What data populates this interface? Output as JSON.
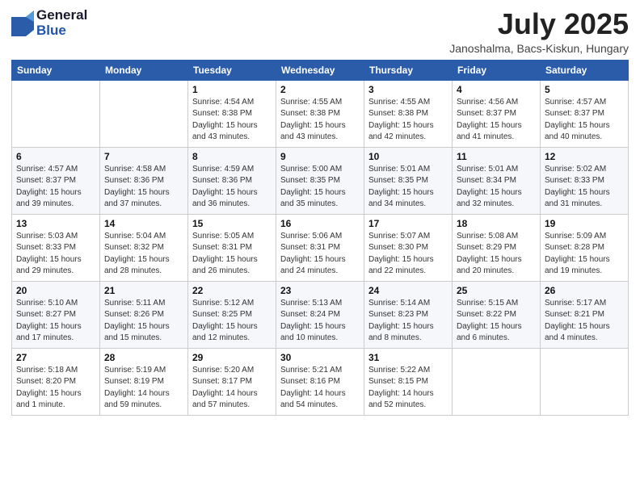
{
  "header": {
    "logo_general": "General",
    "logo_blue": "Blue",
    "title": "July 2025",
    "location": "Janoshalma, Bacs-Kiskun, Hungary"
  },
  "days_of_week": [
    "Sunday",
    "Monday",
    "Tuesday",
    "Wednesday",
    "Thursday",
    "Friday",
    "Saturday"
  ],
  "weeks": [
    [
      {
        "day": "",
        "detail": ""
      },
      {
        "day": "",
        "detail": ""
      },
      {
        "day": "1",
        "detail": "Sunrise: 4:54 AM\nSunset: 8:38 PM\nDaylight: 15 hours\nand 43 minutes."
      },
      {
        "day": "2",
        "detail": "Sunrise: 4:55 AM\nSunset: 8:38 PM\nDaylight: 15 hours\nand 43 minutes."
      },
      {
        "day": "3",
        "detail": "Sunrise: 4:55 AM\nSunset: 8:38 PM\nDaylight: 15 hours\nand 42 minutes."
      },
      {
        "day": "4",
        "detail": "Sunrise: 4:56 AM\nSunset: 8:37 PM\nDaylight: 15 hours\nand 41 minutes."
      },
      {
        "day": "5",
        "detail": "Sunrise: 4:57 AM\nSunset: 8:37 PM\nDaylight: 15 hours\nand 40 minutes."
      }
    ],
    [
      {
        "day": "6",
        "detail": "Sunrise: 4:57 AM\nSunset: 8:37 PM\nDaylight: 15 hours\nand 39 minutes."
      },
      {
        "day": "7",
        "detail": "Sunrise: 4:58 AM\nSunset: 8:36 PM\nDaylight: 15 hours\nand 37 minutes."
      },
      {
        "day": "8",
        "detail": "Sunrise: 4:59 AM\nSunset: 8:36 PM\nDaylight: 15 hours\nand 36 minutes."
      },
      {
        "day": "9",
        "detail": "Sunrise: 5:00 AM\nSunset: 8:35 PM\nDaylight: 15 hours\nand 35 minutes."
      },
      {
        "day": "10",
        "detail": "Sunrise: 5:01 AM\nSunset: 8:35 PM\nDaylight: 15 hours\nand 34 minutes."
      },
      {
        "day": "11",
        "detail": "Sunrise: 5:01 AM\nSunset: 8:34 PM\nDaylight: 15 hours\nand 32 minutes."
      },
      {
        "day": "12",
        "detail": "Sunrise: 5:02 AM\nSunset: 8:33 PM\nDaylight: 15 hours\nand 31 minutes."
      }
    ],
    [
      {
        "day": "13",
        "detail": "Sunrise: 5:03 AM\nSunset: 8:33 PM\nDaylight: 15 hours\nand 29 minutes."
      },
      {
        "day": "14",
        "detail": "Sunrise: 5:04 AM\nSunset: 8:32 PM\nDaylight: 15 hours\nand 28 minutes."
      },
      {
        "day": "15",
        "detail": "Sunrise: 5:05 AM\nSunset: 8:31 PM\nDaylight: 15 hours\nand 26 minutes."
      },
      {
        "day": "16",
        "detail": "Sunrise: 5:06 AM\nSunset: 8:31 PM\nDaylight: 15 hours\nand 24 minutes."
      },
      {
        "day": "17",
        "detail": "Sunrise: 5:07 AM\nSunset: 8:30 PM\nDaylight: 15 hours\nand 22 minutes."
      },
      {
        "day": "18",
        "detail": "Sunrise: 5:08 AM\nSunset: 8:29 PM\nDaylight: 15 hours\nand 20 minutes."
      },
      {
        "day": "19",
        "detail": "Sunrise: 5:09 AM\nSunset: 8:28 PM\nDaylight: 15 hours\nand 19 minutes."
      }
    ],
    [
      {
        "day": "20",
        "detail": "Sunrise: 5:10 AM\nSunset: 8:27 PM\nDaylight: 15 hours\nand 17 minutes."
      },
      {
        "day": "21",
        "detail": "Sunrise: 5:11 AM\nSunset: 8:26 PM\nDaylight: 15 hours\nand 15 minutes."
      },
      {
        "day": "22",
        "detail": "Sunrise: 5:12 AM\nSunset: 8:25 PM\nDaylight: 15 hours\nand 12 minutes."
      },
      {
        "day": "23",
        "detail": "Sunrise: 5:13 AM\nSunset: 8:24 PM\nDaylight: 15 hours\nand 10 minutes."
      },
      {
        "day": "24",
        "detail": "Sunrise: 5:14 AM\nSunset: 8:23 PM\nDaylight: 15 hours\nand 8 minutes."
      },
      {
        "day": "25",
        "detail": "Sunrise: 5:15 AM\nSunset: 8:22 PM\nDaylight: 15 hours\nand 6 minutes."
      },
      {
        "day": "26",
        "detail": "Sunrise: 5:17 AM\nSunset: 8:21 PM\nDaylight: 15 hours\nand 4 minutes."
      }
    ],
    [
      {
        "day": "27",
        "detail": "Sunrise: 5:18 AM\nSunset: 8:20 PM\nDaylight: 15 hours\nand 1 minute."
      },
      {
        "day": "28",
        "detail": "Sunrise: 5:19 AM\nSunset: 8:19 PM\nDaylight: 14 hours\nand 59 minutes."
      },
      {
        "day": "29",
        "detail": "Sunrise: 5:20 AM\nSunset: 8:17 PM\nDaylight: 14 hours\nand 57 minutes."
      },
      {
        "day": "30",
        "detail": "Sunrise: 5:21 AM\nSunset: 8:16 PM\nDaylight: 14 hours\nand 54 minutes."
      },
      {
        "day": "31",
        "detail": "Sunrise: 5:22 AM\nSunset: 8:15 PM\nDaylight: 14 hours\nand 52 minutes."
      },
      {
        "day": "",
        "detail": ""
      },
      {
        "day": "",
        "detail": ""
      }
    ]
  ]
}
